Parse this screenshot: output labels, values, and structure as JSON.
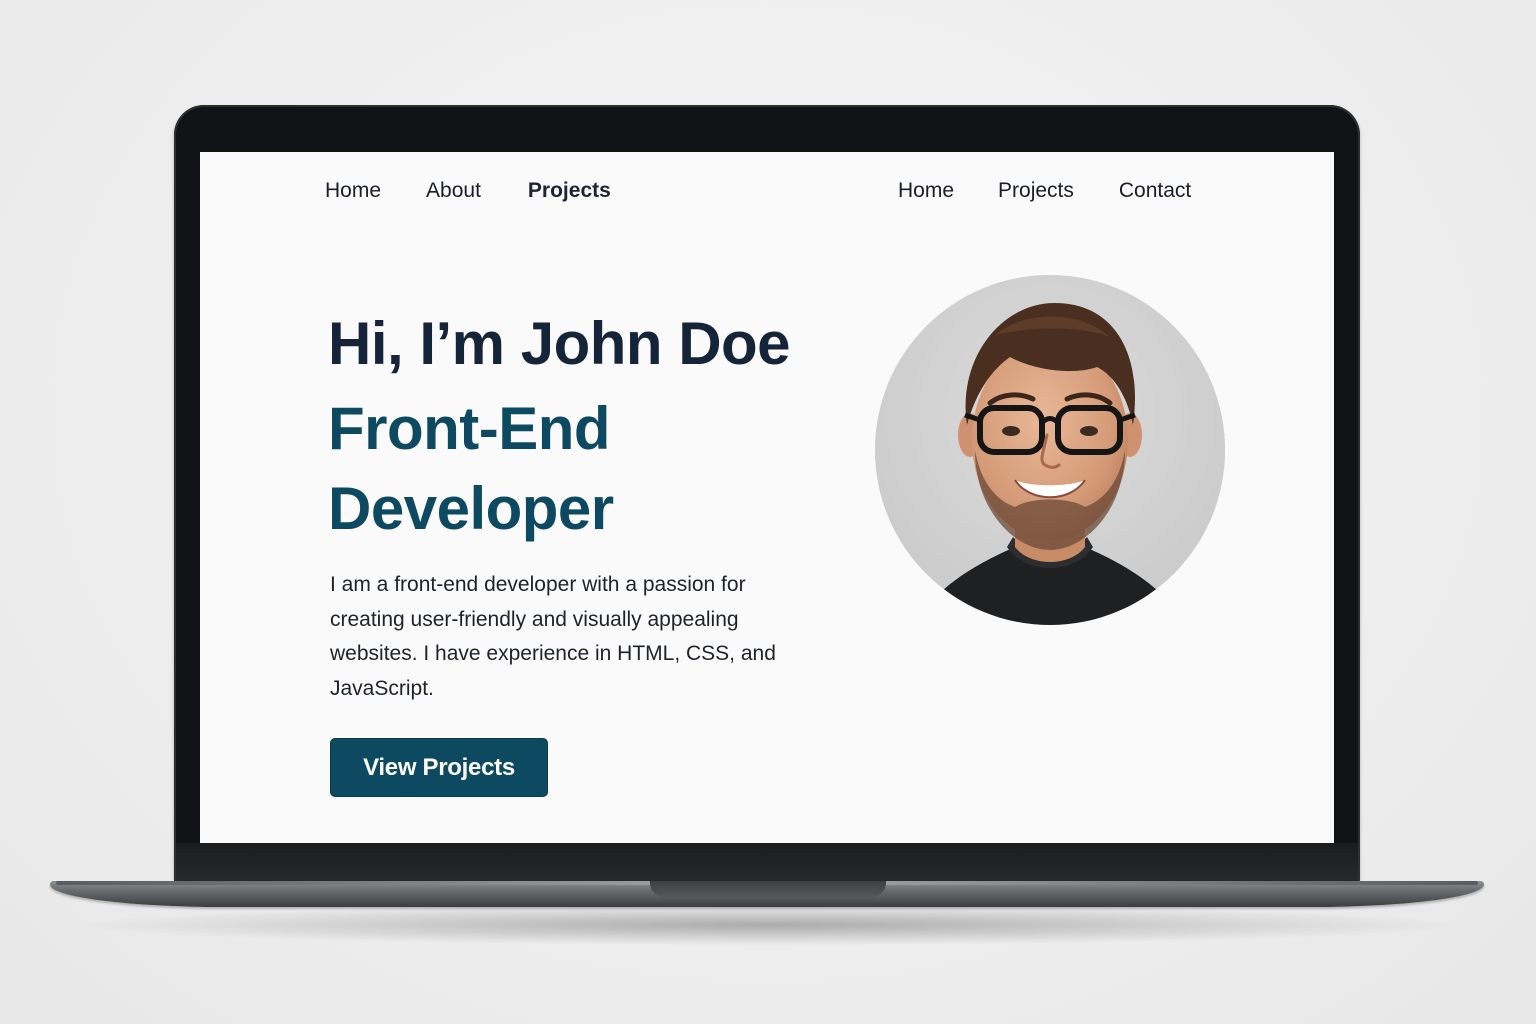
{
  "nav": {
    "left": [
      {
        "label": "Home"
      },
      {
        "label": "About"
      },
      {
        "label": "Projects"
      }
    ],
    "right": [
      {
        "label": "Home"
      },
      {
        "label": "Projects"
      },
      {
        "label": "Contact"
      }
    ]
  },
  "hero": {
    "title": "Hi, I’m John Doe",
    "subtitle": "Front-End Developer",
    "description": "I am a front-end developer with a passion for creating user-friendly and visually appealing websites. I have experience in HTML, CSS, and JavaScript.",
    "cta_label": "View Projects",
    "avatar_icon": "profile-photo"
  },
  "colors": {
    "primary": "#0d4a61",
    "heading": "#16243a",
    "page_background": "#fafafa",
    "avatar_background": "#d3d3d3"
  }
}
